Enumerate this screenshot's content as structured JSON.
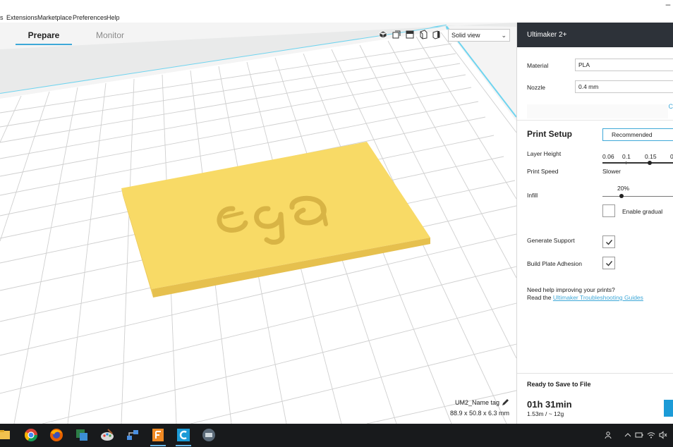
{
  "menu": {
    "items": [
      "s",
      "Extensions",
      "Marketplace",
      "Preferences",
      "Help"
    ]
  },
  "stage_tabs": {
    "prepare": "Prepare",
    "monitor": "Monitor"
  },
  "view": {
    "mode": "Solid view"
  },
  "object": {
    "name": "UM2_Name tag",
    "dims": "88.9 x 50.8 x 6.3 mm",
    "embossed_text": "ega"
  },
  "sidebar": {
    "printer": "Ultimaker 2+",
    "material_label": "Material",
    "material_value": "PLA",
    "nozzle_label": "Nozzle",
    "nozzle_value": "0.4 mm",
    "print_setup_title": "Print Setup",
    "recommended_label": "Recommended",
    "layer_height_label": "Layer Height",
    "layer_height_ticks": [
      "0.06",
      "0.1",
      "0.15",
      "0"
    ],
    "print_speed_label": "Print Speed",
    "print_speed_value": "Slower",
    "infill_label": "Infill",
    "infill_value": "20%",
    "infill_fraction": 0.2,
    "enable_gradual_label": "Enable gradual",
    "enable_gradual_checked": false,
    "generate_support_label": "Generate Support",
    "generate_support_checked": true,
    "adhesion_label": "Build Plate Adhesion",
    "adhesion_checked": true,
    "help_line1": "Need help improving your prints?",
    "help_read": "Read the",
    "help_link": "Ultimaker Troubleshooting Guides",
    "ready_label": "Ready to Save to File",
    "print_time": "01h 31min",
    "material_estimate": "1.53m / ~ 12g",
    "faded_link": "C"
  },
  "colors": {
    "accent": "#3ea8d8",
    "model": "#f7d862",
    "header_dark": "#2d3239",
    "taskbar": "#181a1c"
  },
  "taskbar": {
    "icons": [
      "file-explorer-icon",
      "chrome-icon",
      "firefox-icon",
      "app-icon",
      "paint-icon",
      "network-icon",
      "f-app-icon",
      "cura-icon",
      "app2-icon"
    ]
  }
}
